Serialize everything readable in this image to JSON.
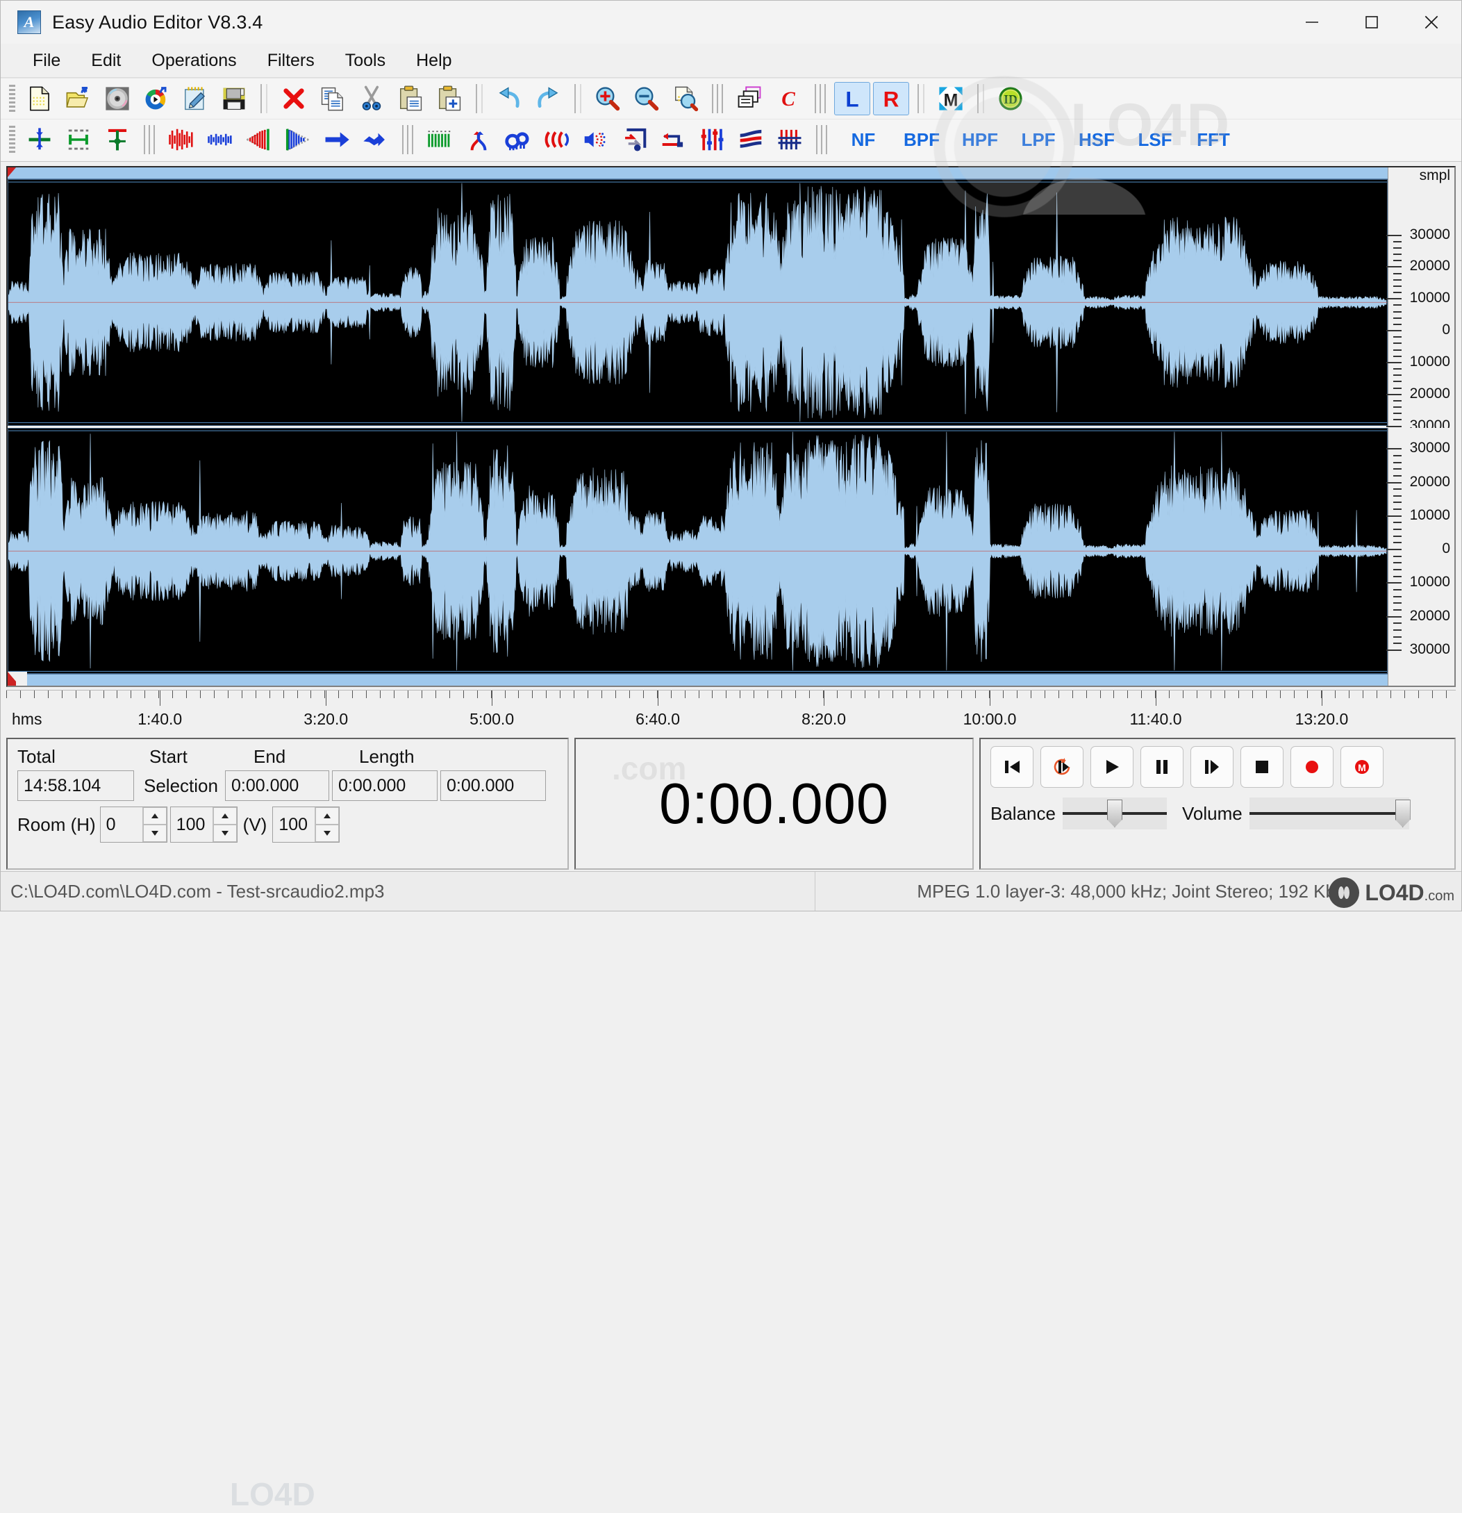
{
  "window": {
    "title": "Easy Audio Editor V8.3.4",
    "app_icon": "app-logo-icon",
    "minimize": "minimize-icon",
    "maximize": "maximize-icon",
    "close": "close-icon"
  },
  "menubar": {
    "items": [
      {
        "label": "File"
      },
      {
        "label": "Edit"
      },
      {
        "label": "Operations"
      },
      {
        "label": "Filters"
      },
      {
        "label": "Tools"
      },
      {
        "label": "Help"
      }
    ]
  },
  "toolbar_main": {
    "buttons": [
      {
        "name": "new-file-icon",
        "title": "New"
      },
      {
        "name": "open-file-icon",
        "title": "Open"
      },
      {
        "name": "cd-ripper-icon",
        "title": "CD Ripper"
      },
      {
        "name": "media-player-icon",
        "title": "Play File"
      },
      {
        "name": "edit-notes-icon",
        "title": "Edit"
      },
      {
        "name": "save-icon",
        "title": "Save"
      },
      {
        "name": "delete-icon",
        "title": "Delete"
      },
      {
        "name": "copy-icon",
        "title": "Copy"
      },
      {
        "name": "cut-icon",
        "title": "Cut"
      },
      {
        "name": "paste-icon",
        "title": "Paste"
      },
      {
        "name": "paste-new-icon",
        "title": "Paste As New"
      },
      {
        "name": "undo-icon",
        "title": "Undo"
      },
      {
        "name": "redo-icon",
        "title": "Redo"
      },
      {
        "name": "zoom-in-icon",
        "title": "Zoom In"
      },
      {
        "name": "zoom-out-icon",
        "title": "Zoom Out"
      },
      {
        "name": "zoom-selection-icon",
        "title": "Zoom Selection"
      },
      {
        "name": "batch-convert-icon",
        "title": "Batch Convert"
      },
      {
        "name": "compress-icon",
        "title": "C"
      },
      {
        "name": "channel-left-icon",
        "title": "L",
        "label": "L",
        "active": true
      },
      {
        "name": "channel-right-icon",
        "title": "R",
        "label": "R",
        "active": true
      },
      {
        "name": "channel-mono-icon",
        "title": "M",
        "label": "M"
      },
      {
        "name": "id-tag-icon",
        "title": "ID3 Tag",
        "label": "ID"
      }
    ]
  },
  "toolbar_effects": {
    "buttons": [
      {
        "name": "insert-silence-icon"
      },
      {
        "name": "trim-icon"
      },
      {
        "name": "cursor-center-icon"
      },
      {
        "name": "amplify-up-icon"
      },
      {
        "name": "amplify-down-icon"
      },
      {
        "name": "fade-in-icon"
      },
      {
        "name": "fade-out-icon"
      },
      {
        "name": "arrow-right-icon"
      },
      {
        "name": "arrow-double-right-icon"
      },
      {
        "name": "normalize-green-icon"
      },
      {
        "name": "crossfade-icon"
      },
      {
        "name": "loop-wave-icon"
      },
      {
        "name": "echo-icon"
      },
      {
        "name": "reverb-icon"
      },
      {
        "name": "stretch-icon"
      },
      {
        "name": "reverse-icon"
      },
      {
        "name": "equalizer-icon"
      },
      {
        "name": "filter-curve-icon"
      },
      {
        "name": "vibrato-icon"
      }
    ],
    "filters": [
      {
        "label": "NF"
      },
      {
        "label": "BPF"
      },
      {
        "label": "HPF"
      },
      {
        "label": "LPF"
      },
      {
        "label": "HSF"
      },
      {
        "label": "LSF"
      },
      {
        "label": "FFT"
      }
    ]
  },
  "waveform": {
    "vruler_unit": "smpl",
    "vruler_labels": [
      "30000",
      "20000",
      "10000",
      "0",
      "10000",
      "20000",
      "30000"
    ],
    "hruler_unit": "hms",
    "hruler_labels": [
      "1:40.0",
      "3:20.0",
      "5:00.0",
      "6:40.0",
      "8:20.0",
      "10:00.0",
      "11:40.0",
      "13:20.0"
    ],
    "channels": [
      "left-channel",
      "right-channel"
    ],
    "wave_color": "#a8cdec",
    "background_color": "#000000"
  },
  "info_panel": {
    "total_label": "Total",
    "total_value": "14:58.104",
    "selection_label": "Selection",
    "start_label": "Start",
    "start_value": "0:00.000",
    "end_label": "End",
    "end_value": "0:00.000",
    "length_label": "Length",
    "length_value": "0:00.000",
    "room_h_label": "Room (H)",
    "room_h_value": "0",
    "room_h_value2": "100",
    "room_v_label": "(V)",
    "room_v_value": "100"
  },
  "time_display": {
    "current_time": "0:00.000"
  },
  "transport": {
    "buttons": [
      {
        "name": "skip-to-start-button",
        "icon": "skip-back-icon"
      },
      {
        "name": "loop-play-button",
        "icon": "loop-icon"
      },
      {
        "name": "play-button",
        "icon": "play-icon"
      },
      {
        "name": "pause-button",
        "icon": "pause-icon"
      },
      {
        "name": "step-forward-button",
        "icon": "step-forward-icon"
      },
      {
        "name": "stop-button",
        "icon": "stop-icon"
      },
      {
        "name": "record-button",
        "icon": "record-icon"
      },
      {
        "name": "record-mono-button",
        "icon": "record-mono-icon"
      }
    ],
    "balance_label": "Balance",
    "balance_value": 50,
    "volume_label": "Volume",
    "volume_value": 100
  },
  "statusbar": {
    "file_path": "C:\\LO4D.com\\LO4D.com - Test-srcaudio2.mp3",
    "format_info": "MPEG 1.0 layer-3: 48,000 kHz; Joint Stereo; 192 Kbps;"
  },
  "watermark": {
    "brand": "LO4D",
    "brand_suffix": ".com"
  },
  "colors": {
    "accent_blue": "#1569e0",
    "wave": "#a8cdec",
    "record_red": "#e01b1b",
    "channel_left": "#0b3fd1",
    "channel_right": "#e81010"
  }
}
